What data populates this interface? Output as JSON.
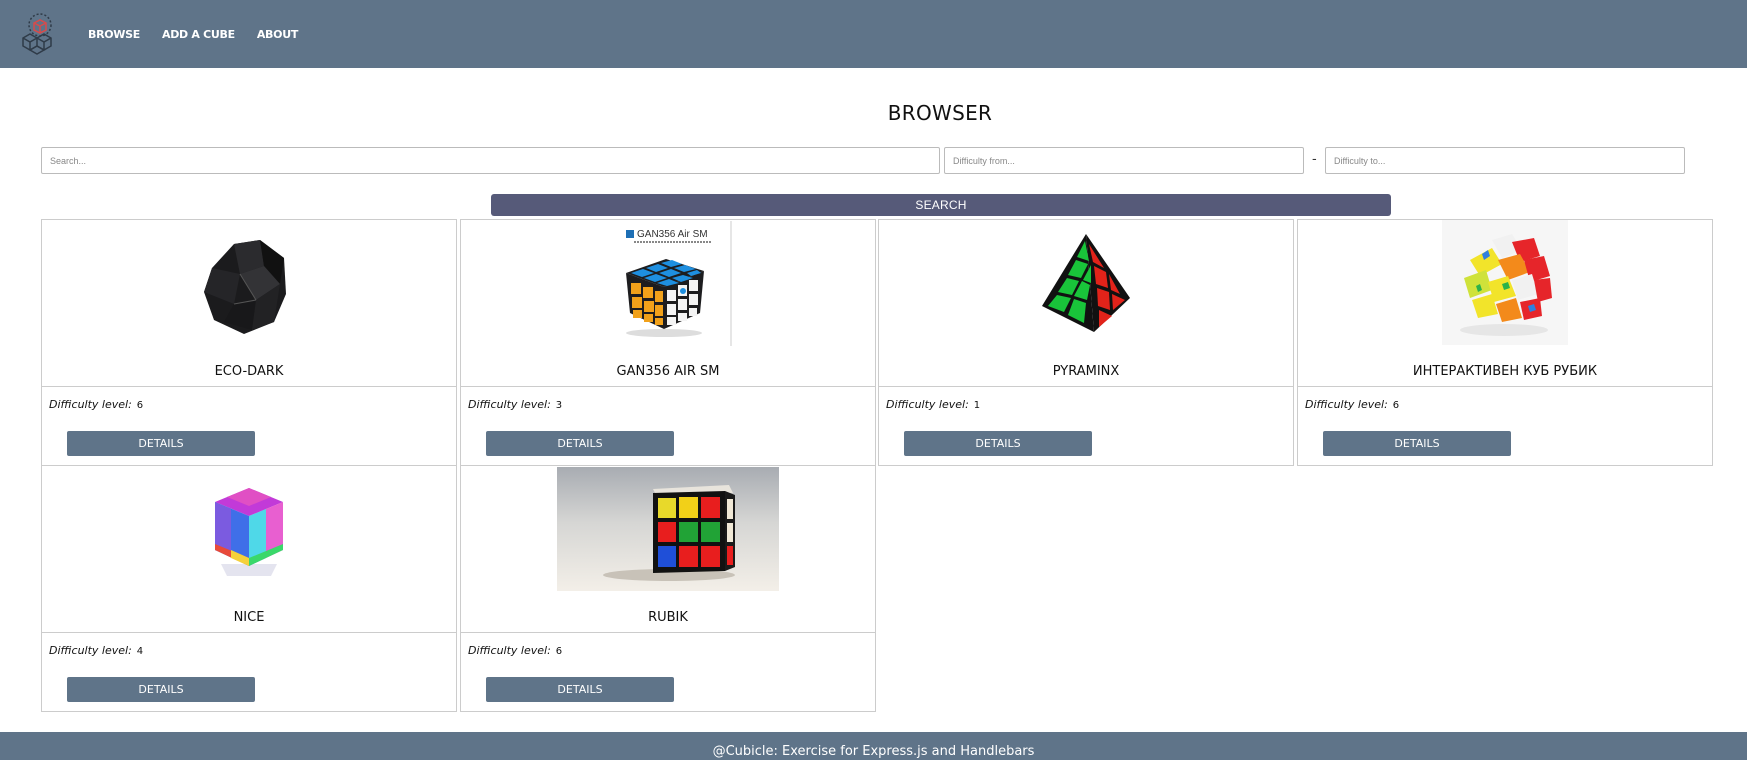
{
  "nav": {
    "logo_icon": "cubes-logo-icon",
    "links": [
      "BROWSE",
      "ADD A CUBE",
      "ABOUT"
    ]
  },
  "page": {
    "title": "BROWSER"
  },
  "filters": {
    "search_placeholder": "Search...",
    "from_placeholder": "Difficulty from...",
    "separator": "-",
    "to_placeholder": "Difficulty to...",
    "search_label": "SEARCH"
  },
  "cards": [
    {
      "name": "ECO-DARK",
      "difficulty_label": "Difficulty level:",
      "difficulty": "6",
      "details_label": "DETAILS"
    },
    {
      "name": "GAN356 AIR SM",
      "difficulty_label": "Difficulty level:",
      "difficulty": "3",
      "details_label": "DETAILS",
      "image_caption": "GAN356 Air SM"
    },
    {
      "name": "PYRAMINX",
      "difficulty_label": "Difficulty level:",
      "difficulty": "1",
      "details_label": "DETAILS"
    },
    {
      "name": "ИНТЕРАКТИВЕН КУБ РУБИК",
      "difficulty_label": "Difficulty level:",
      "difficulty": "6",
      "details_label": "DETAILS"
    },
    {
      "name": "NICE",
      "difficulty_label": "Difficulty level:",
      "difficulty": "4",
      "details_label": "DETAILS"
    },
    {
      "name": "RUBIK",
      "difficulty_label": "Difficulty level:",
      "difficulty": "6",
      "details_label": "DETAILS"
    }
  ],
  "footer": {
    "text": "@Cubicle: Exercise for Express.js and Handlebars"
  },
  "colors": {
    "header": "#5f7489",
    "search_button": "#565a79",
    "details_button": "#5f7489"
  }
}
